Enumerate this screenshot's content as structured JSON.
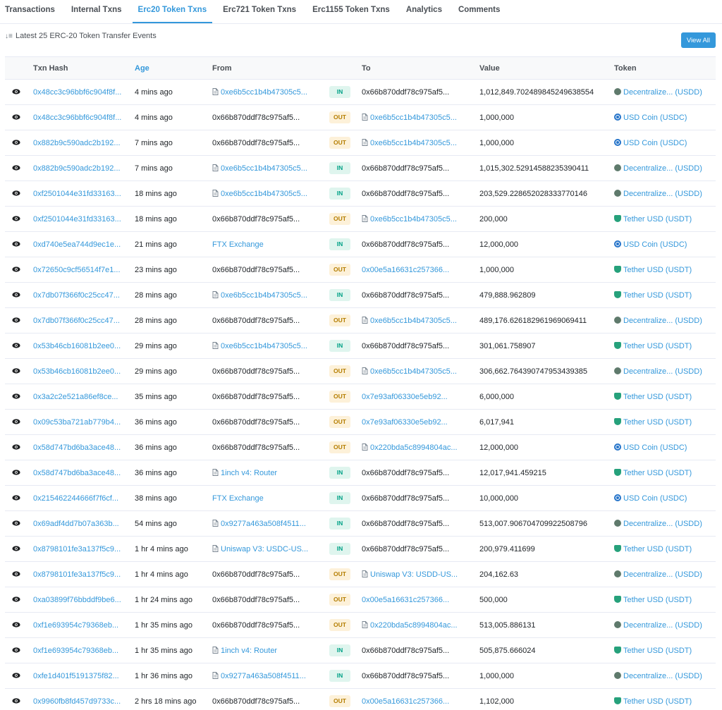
{
  "tabs": [
    {
      "label": "Transactions",
      "active": false
    },
    {
      "label": "Internal Txns",
      "active": false
    },
    {
      "label": "Erc20 Token Txns",
      "active": true
    },
    {
      "label": "Erc721 Token Txns",
      "active": false
    },
    {
      "label": "Erc1155 Token Txns",
      "active": false
    },
    {
      "label": "Analytics",
      "active": false
    },
    {
      "label": "Comments",
      "active": false
    }
  ],
  "summary": {
    "text": "Latest 25 ERC-20 Token Transfer Events",
    "icon": "sort-icon"
  },
  "view_all_label": "View All",
  "columns": {
    "hash": "Txn Hash",
    "age": "Age",
    "from": "From",
    "to": "To",
    "value": "Value",
    "token": "Token"
  },
  "colors": {
    "accent": "#3498db",
    "in_bg": "#dff5ee",
    "in_fg": "#00a186",
    "out_bg": "#fdf1d9",
    "out_fg": "#b47d00"
  },
  "rows": [
    {
      "hash": "0x48cc3c96bbf6c904f8f...",
      "age": "4 mins ago",
      "from": "0xe6b5cc1b4b47305c5...",
      "from_link": true,
      "from_contract": true,
      "dir": "IN",
      "to": "0x66b870ddf78c975af5...",
      "to_link": false,
      "to_contract": false,
      "value": "1,012,849.702489845249638554",
      "token": "Decentralize... (USDD)",
      "token_icon": "usdd"
    },
    {
      "hash": "0x48cc3c96bbf6c904f8f...",
      "age": "4 mins ago",
      "from": "0x66b870ddf78c975af5...",
      "from_link": false,
      "from_contract": false,
      "dir": "OUT",
      "to": "0xe6b5cc1b4b47305c5...",
      "to_link": true,
      "to_contract": true,
      "value": "1,000,000",
      "token": "USD Coin (USDC)",
      "token_icon": "usdc"
    },
    {
      "hash": "0x882b9c590adc2b192...",
      "age": "7 mins ago",
      "from": "0x66b870ddf78c975af5...",
      "from_link": false,
      "from_contract": false,
      "dir": "OUT",
      "to": "0xe6b5cc1b4b47305c5...",
      "to_link": true,
      "to_contract": true,
      "value": "1,000,000",
      "token": "USD Coin (USDC)",
      "token_icon": "usdc"
    },
    {
      "hash": "0x882b9c590adc2b192...",
      "age": "7 mins ago",
      "from": "0xe6b5cc1b4b47305c5...",
      "from_link": true,
      "from_contract": true,
      "dir": "IN",
      "to": "0x66b870ddf78c975af5...",
      "to_link": false,
      "to_contract": false,
      "value": "1,015,302.52914588235390411",
      "token": "Decentralize... (USDD)",
      "token_icon": "usdd"
    },
    {
      "hash": "0xf2501044e31fd33163...",
      "age": "18 mins ago",
      "from": "0xe6b5cc1b4b47305c5...",
      "from_link": true,
      "from_contract": true,
      "dir": "IN",
      "to": "0x66b870ddf78c975af5...",
      "to_link": false,
      "to_contract": false,
      "value": "203,529.228652028333770146",
      "token": "Decentralize... (USDD)",
      "token_icon": "usdd"
    },
    {
      "hash": "0xf2501044e31fd33163...",
      "age": "18 mins ago",
      "from": "0x66b870ddf78c975af5...",
      "from_link": false,
      "from_contract": false,
      "dir": "OUT",
      "to": "0xe6b5cc1b4b47305c5...",
      "to_link": true,
      "to_contract": true,
      "value": "200,000",
      "token": "Tether USD (USDT)",
      "token_icon": "usdt"
    },
    {
      "hash": "0xd740e5ea744d9ec1e...",
      "age": "21 mins ago",
      "from": "FTX Exchange",
      "from_link": true,
      "from_contract": false,
      "dir": "IN",
      "to": "0x66b870ddf78c975af5...",
      "to_link": false,
      "to_contract": false,
      "value": "12,000,000",
      "token": "USD Coin (USDC)",
      "token_icon": "usdc"
    },
    {
      "hash": "0x72650c9cf56514f7e1...",
      "age": "23 mins ago",
      "from": "0x66b870ddf78c975af5...",
      "from_link": false,
      "from_contract": false,
      "dir": "OUT",
      "to": "0x00e5a16631c257366...",
      "to_link": true,
      "to_contract": false,
      "value": "1,000,000",
      "token": "Tether USD (USDT)",
      "token_icon": "usdt"
    },
    {
      "hash": "0x7db07f366f0c25cc47...",
      "age": "28 mins ago",
      "from": "0xe6b5cc1b4b47305c5...",
      "from_link": true,
      "from_contract": true,
      "dir": "IN",
      "to": "0x66b870ddf78c975af5...",
      "to_link": false,
      "to_contract": false,
      "value": "479,888.962809",
      "token": "Tether USD (USDT)",
      "token_icon": "usdt"
    },
    {
      "hash": "0x7db07f366f0c25cc47...",
      "age": "28 mins ago",
      "from": "0x66b870ddf78c975af5...",
      "from_link": false,
      "from_contract": false,
      "dir": "OUT",
      "to": "0xe6b5cc1b4b47305c5...",
      "to_link": true,
      "to_contract": true,
      "value": "489,176.626182961969069411",
      "token": "Decentralize... (USDD)",
      "token_icon": "usdd"
    },
    {
      "hash": "0x53b46cb16081b2ee0...",
      "age": "29 mins ago",
      "from": "0xe6b5cc1b4b47305c5...",
      "from_link": true,
      "from_contract": true,
      "dir": "IN",
      "to": "0x66b870ddf78c975af5...",
      "to_link": false,
      "to_contract": false,
      "value": "301,061.758907",
      "token": "Tether USD (USDT)",
      "token_icon": "usdt"
    },
    {
      "hash": "0x53b46cb16081b2ee0...",
      "age": "29 mins ago",
      "from": "0x66b870ddf78c975af5...",
      "from_link": false,
      "from_contract": false,
      "dir": "OUT",
      "to": "0xe6b5cc1b4b47305c5...",
      "to_link": true,
      "to_contract": true,
      "value": "306,662.764390747953439385",
      "token": "Decentralize... (USDD)",
      "token_icon": "usdd"
    },
    {
      "hash": "0x3a2c2e521a86ef8ce...",
      "age": "35 mins ago",
      "from": "0x66b870ddf78c975af5...",
      "from_link": false,
      "from_contract": false,
      "dir": "OUT",
      "to": "0x7e93af06330e5eb92...",
      "to_link": true,
      "to_contract": false,
      "value": "6,000,000",
      "token": "Tether USD (USDT)",
      "token_icon": "usdt"
    },
    {
      "hash": "0x09c53ba721ab779b4...",
      "age": "36 mins ago",
      "from": "0x66b870ddf78c975af5...",
      "from_link": false,
      "from_contract": false,
      "dir": "OUT",
      "to": "0x7e93af06330e5eb92...",
      "to_link": true,
      "to_contract": false,
      "value": "6,017,941",
      "token": "Tether USD (USDT)",
      "token_icon": "usdt"
    },
    {
      "hash": "0x58d747bd6ba3ace48...",
      "age": "36 mins ago",
      "from": "0x66b870ddf78c975af5...",
      "from_link": false,
      "from_contract": false,
      "dir": "OUT",
      "to": "0x220bda5c8994804ac...",
      "to_link": true,
      "to_contract": true,
      "value": "12,000,000",
      "token": "USD Coin (USDC)",
      "token_icon": "usdc"
    },
    {
      "hash": "0x58d747bd6ba3ace48...",
      "age": "36 mins ago",
      "from": "1inch v4: Router",
      "from_link": true,
      "from_contract": true,
      "dir": "IN",
      "to": "0x66b870ddf78c975af5...",
      "to_link": false,
      "to_contract": false,
      "value": "12,017,941.459215",
      "token": "Tether USD (USDT)",
      "token_icon": "usdt"
    },
    {
      "hash": "0x215462244666f7f6cf...",
      "age": "38 mins ago",
      "from": "FTX Exchange",
      "from_link": true,
      "from_contract": false,
      "dir": "IN",
      "to": "0x66b870ddf78c975af5...",
      "to_link": false,
      "to_contract": false,
      "value": "10,000,000",
      "token": "USD Coin (USDC)",
      "token_icon": "usdc"
    },
    {
      "hash": "0x69adf4dd7b07a363b...",
      "age": "54 mins ago",
      "from": "0x9277a463a508f4511...",
      "from_link": true,
      "from_contract": true,
      "dir": "IN",
      "to": "0x66b870ddf78c975af5...",
      "to_link": false,
      "to_contract": false,
      "value": "513,007.906704709922508796",
      "token": "Decentralize... (USDD)",
      "token_icon": "usdd"
    },
    {
      "hash": "0x8798101fe3a137f5c9...",
      "age": "1 hr 4 mins ago",
      "from": "Uniswap V3: USDC-US...",
      "from_link": true,
      "from_contract": true,
      "dir": "IN",
      "to": "0x66b870ddf78c975af5...",
      "to_link": false,
      "to_contract": false,
      "value": "200,979.411699",
      "token": "Tether USD (USDT)",
      "token_icon": "usdt"
    },
    {
      "hash": "0x8798101fe3a137f5c9...",
      "age": "1 hr 4 mins ago",
      "from": "0x66b870ddf78c975af5...",
      "from_link": false,
      "from_contract": false,
      "dir": "OUT",
      "to": "Uniswap V3: USDD-US...",
      "to_link": true,
      "to_contract": true,
      "value": "204,162.63",
      "token": "Decentralize... (USDD)",
      "token_icon": "usdd"
    },
    {
      "hash": "0xa03899f76bbddf9be6...",
      "age": "1 hr 24 mins ago",
      "from": "0x66b870ddf78c975af5...",
      "from_link": false,
      "from_contract": false,
      "dir": "OUT",
      "to": "0x00e5a16631c257366...",
      "to_link": true,
      "to_contract": false,
      "value": "500,000",
      "token": "Tether USD (USDT)",
      "token_icon": "usdt"
    },
    {
      "hash": "0xf1e693954c79368eb...",
      "age": "1 hr 35 mins ago",
      "from": "0x66b870ddf78c975af5...",
      "from_link": false,
      "from_contract": false,
      "dir": "OUT",
      "to": "0x220bda5c8994804ac...",
      "to_link": true,
      "to_contract": true,
      "value": "513,005.886131",
      "token": "Decentralize... (USDD)",
      "token_icon": "usdd"
    },
    {
      "hash": "0xf1e693954c79368eb...",
      "age": "1 hr 35 mins ago",
      "from": "1inch v4: Router",
      "from_link": true,
      "from_contract": true,
      "dir": "IN",
      "to": "0x66b870ddf78c975af5...",
      "to_link": false,
      "to_contract": false,
      "value": "505,875.666024",
      "token": "Tether USD (USDT)",
      "token_icon": "usdt"
    },
    {
      "hash": "0xfe1d401f5191375f82...",
      "age": "1 hr 36 mins ago",
      "from": "0x9277a463a508f4511...",
      "from_link": true,
      "from_contract": true,
      "dir": "IN",
      "to": "0x66b870ddf78c975af5...",
      "to_link": false,
      "to_contract": false,
      "value": "1,000,000",
      "token": "Decentralize... (USDD)",
      "token_icon": "usdd"
    },
    {
      "hash": "0x9960fb8fd457d9733c...",
      "age": "2 hrs 18 mins ago",
      "from": "0x66b870ddf78c975af5...",
      "from_link": false,
      "from_contract": false,
      "dir": "OUT",
      "to": "0x00e5a16631c257366...",
      "to_link": true,
      "to_contract": false,
      "value": "1,102,000",
      "token": "Tether USD (USDT)",
      "token_icon": "usdt"
    }
  ]
}
